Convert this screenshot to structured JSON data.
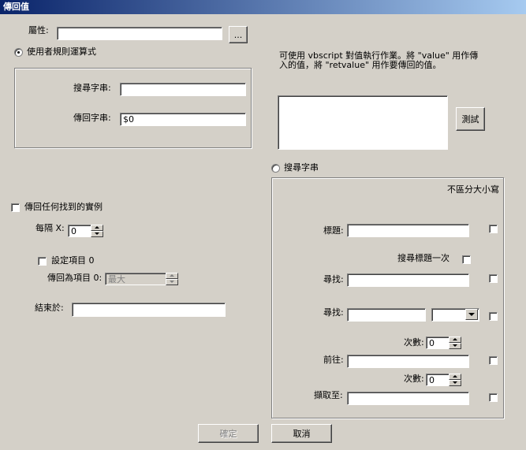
{
  "window": {
    "title": "傳回值"
  },
  "property": {
    "label": "屬性:",
    "value": "",
    "browse_label": "..."
  },
  "regex": {
    "radio_label": "使用者規則運算式",
    "search_label": "搜尋字串:",
    "search_value": "",
    "return_label": "傳回字串:",
    "return_value": "$0"
  },
  "vbscript": {
    "description_line1": "可使用 vbscript 對值執行作業。將 \"value\" 用作傳",
    "description_line2": "入的值，將 \"retvalue\" 用作要傳回的值。",
    "script_value": "",
    "test_label": "測試"
  },
  "instances": {
    "return_any_label": "傳回任何找到的實例",
    "every_x_label": "每隔 X:",
    "every_x_value": "0",
    "set_item_label": "設定項目 0",
    "return_as_item_label": "傳回為項目 0:",
    "return_as_item_value": "最大",
    "ends_at_label": "結束於:",
    "ends_at_value": ""
  },
  "search_string": {
    "radio_label": "搜尋字串",
    "case_insensitive_label": "不區分大小寫",
    "title_label": "標題:",
    "title_value": "",
    "search_title_once_label": "搜尋標題一次",
    "find1_label": "尋找:",
    "find1_value": "",
    "find2_label": "尋找:",
    "find2_value": "",
    "find2_select_value": "",
    "count1_label": "次數:",
    "count1_value": "0",
    "goto_label": "前往:",
    "goto_value": "",
    "count2_label": "次數:",
    "count2_value": "0",
    "extract_label": "擷取至:",
    "extract_value": ""
  },
  "footer": {
    "ok_label": "確定",
    "cancel_label": "取消"
  }
}
